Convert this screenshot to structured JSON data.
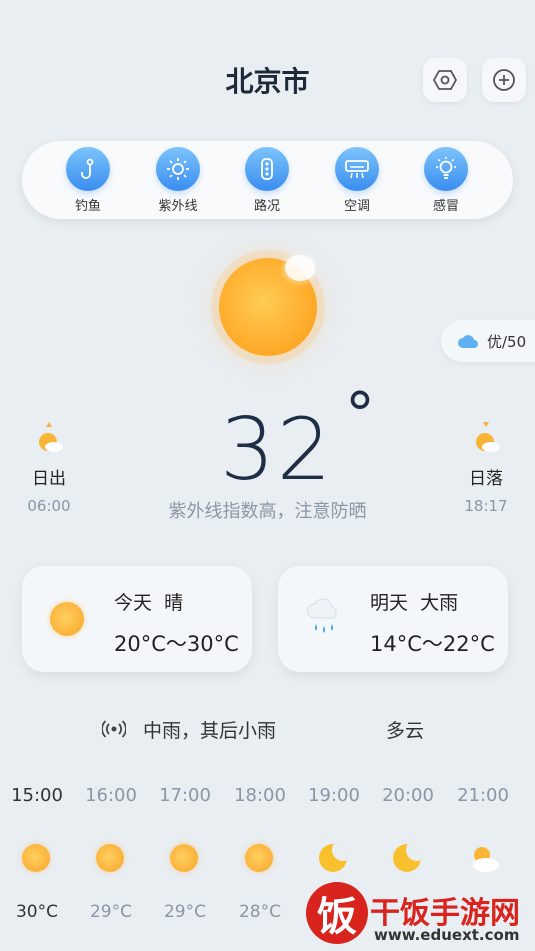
{
  "header": {
    "city": "北京市",
    "settings_icon": "hexagon-settings-icon",
    "add_icon": "plus-circle-icon"
  },
  "services": [
    {
      "label": "钓鱼",
      "icon": "fishing-hook-icon"
    },
    {
      "label": "紫外线",
      "icon": "sun-uv-icon"
    },
    {
      "label": "路况",
      "icon": "traffic-light-icon"
    },
    {
      "label": "空调",
      "icon": "air-conditioner-icon"
    },
    {
      "label": "感冒",
      "icon": "lightbulb-icon"
    }
  ],
  "air_quality": {
    "label": "优/50",
    "icon": "cloud-icon"
  },
  "current": {
    "temperature": "32",
    "degree": "°",
    "tip": "紫外线指数高，注意防晒"
  },
  "sun": {
    "sunrise_label": "日出",
    "sunrise_time": "06:00",
    "sunset_label": "日落",
    "sunset_time": "18:17"
  },
  "today": {
    "title": "今天  晴",
    "range": "20°C～30°C",
    "icon": "sun-icon"
  },
  "tomorrow": {
    "title": "明天  大雨",
    "range": "14°C～22°C",
    "icon": "rain-cloud-icon"
  },
  "forecast_line": {
    "icon": "broadcast-icon",
    "text1": "中雨，其后小雨",
    "text2": "多云"
  },
  "hourly": [
    {
      "time": "15:00",
      "temp": "30°C",
      "icon": "sun-icon"
    },
    {
      "time": "16:00",
      "temp": "29°C",
      "icon": "sun-icon"
    },
    {
      "time": "17:00",
      "temp": "29°C",
      "icon": "sun-icon"
    },
    {
      "time": "18:00",
      "temp": "28°C",
      "icon": "sun-icon"
    },
    {
      "time": "19:00",
      "temp": "",
      "icon": "moon-icon"
    },
    {
      "time": "20:00",
      "temp": "",
      "icon": "moon-icon"
    },
    {
      "time": "21:00",
      "temp": "",
      "icon": "partly-cloudy-icon"
    }
  ],
  "watermark": {
    "brand": "干饭手游网",
    "url": "www.eduext.com",
    "logo_char": "饭"
  },
  "colors": {
    "accent_blue": "#3a8df0",
    "sun_orange": "#f8a327",
    "watermark_red": "#d9231d"
  }
}
